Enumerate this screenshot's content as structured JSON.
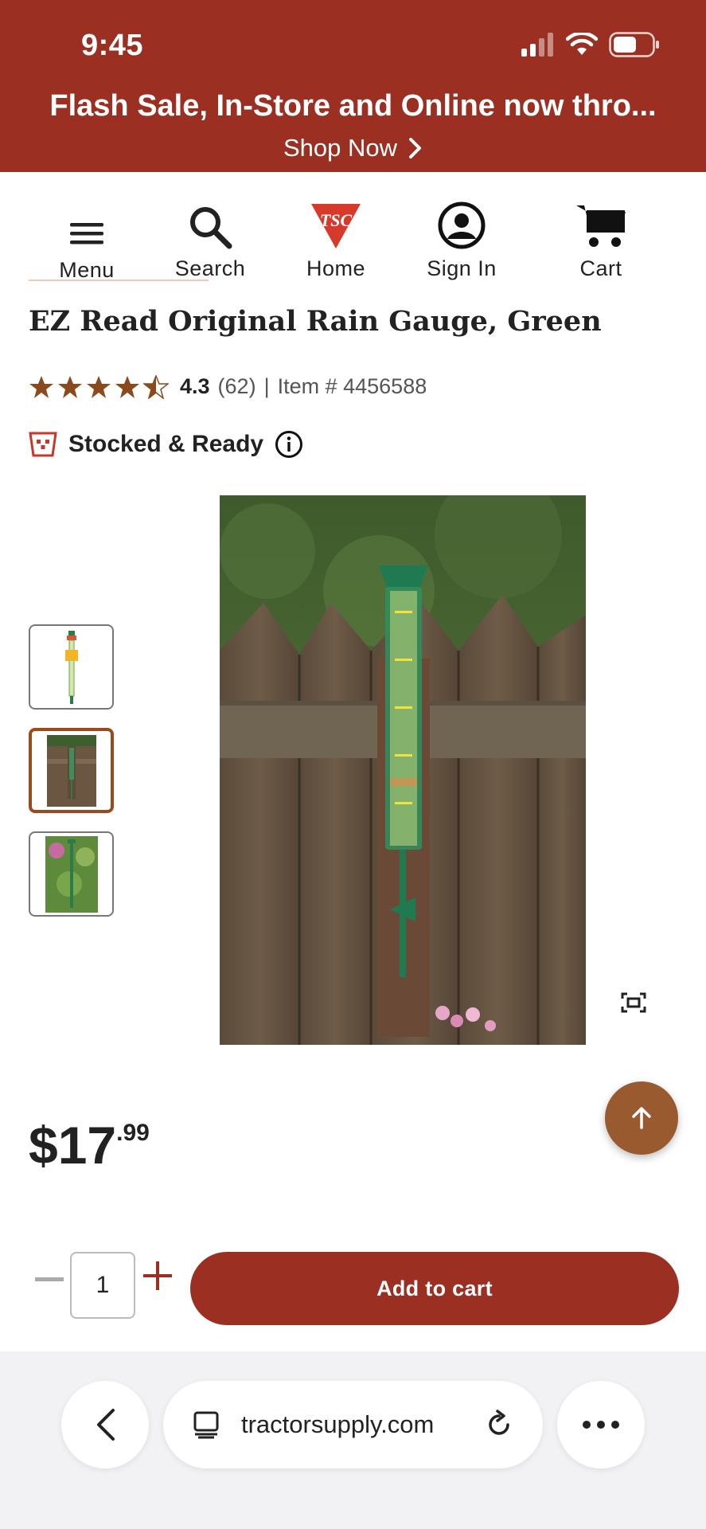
{
  "status_bar": {
    "time": "9:45"
  },
  "promo": {
    "title": "Flash Sale, In-Store and Online now thro...",
    "link_label": "Shop Now"
  },
  "nav": {
    "items": [
      {
        "label": "Menu",
        "icon": "hamburger-icon"
      },
      {
        "label": "Search",
        "icon": "search-icon"
      },
      {
        "label": "Home",
        "icon": "tsc-logo-icon"
      },
      {
        "label": "Sign In",
        "icon": "user-icon"
      },
      {
        "label": "Cart",
        "icon": "cart-icon"
      }
    ],
    "logo_text": "TSC"
  },
  "product": {
    "title": "EZ Read Original Rain Gauge, Green",
    "rating": 4.3,
    "rating_value": "4.3",
    "review_count": "(62)",
    "separator": "|",
    "item_number": "Item # 4456588",
    "stock_label": "Stocked & Ready",
    "price_dollars": "$17",
    "price_cents": ".99",
    "thumbnail_count": 3,
    "active_thumbnail": 2
  },
  "cart": {
    "quantity": "1",
    "add_label": "Add to cart"
  },
  "browser": {
    "url": "tractorsupply.com"
  },
  "colors": {
    "brand_red": "#9a2f22",
    "star_brown": "#8a4a1e",
    "scroll_button": "#9a5a30"
  }
}
